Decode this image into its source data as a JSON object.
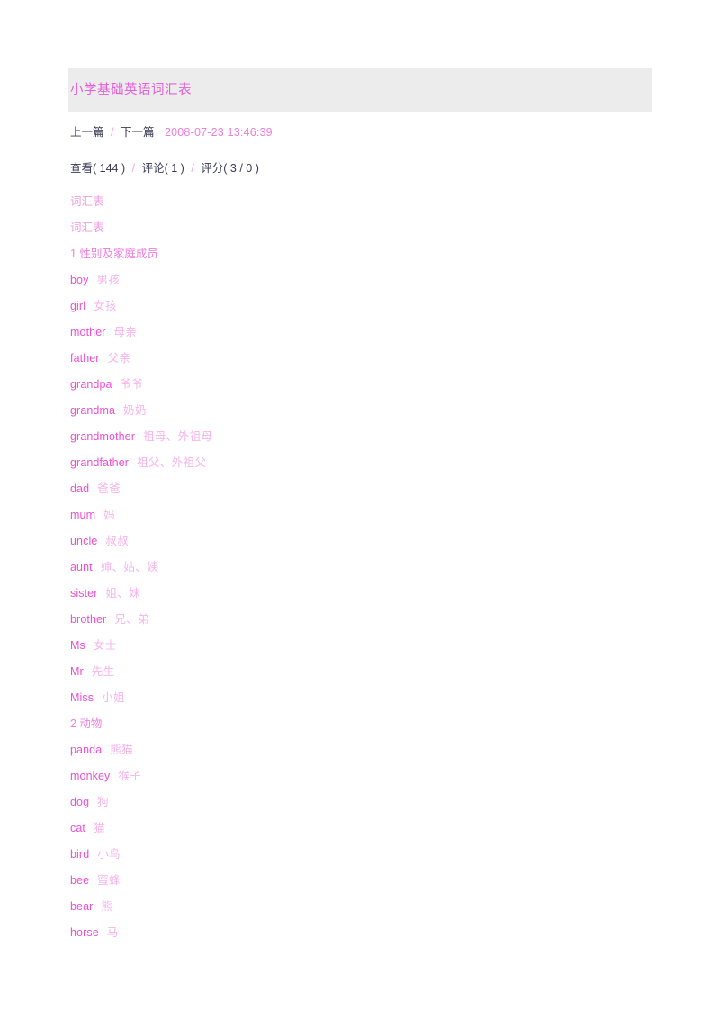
{
  "article": {
    "title": "小学基础英语词汇表",
    "nav": {
      "prev_label": "上一篇",
      "next_label": "下一篇",
      "separator": "/",
      "timestamp": "2008-07-23 13:46:39"
    },
    "stats": {
      "views": "查看( 144 )",
      "comments": "评论( 1 )",
      "rating": "评分( 3 / 0 )",
      "separator": "/"
    }
  },
  "colors": {
    "band_background": "#ececec",
    "title_text": "#e45fd8",
    "term_text": "#ef4fd4",
    "gloss_text": "#f7b4ec",
    "meta_text": "#3a3a55",
    "timestamp_text": "#f07fd8",
    "page_background": "#ffffff"
  },
  "body_lines": [
    {
      "type": "heading",
      "text": "词汇表"
    },
    {
      "type": "heading",
      "text": "词汇表"
    },
    {
      "type": "section",
      "text": "1 性别及家庭成员"
    },
    {
      "type": "entry",
      "term": "boy",
      "gloss": "男孩"
    },
    {
      "type": "entry",
      "term": "girl",
      "gloss": "女孩"
    },
    {
      "type": "entry",
      "term": "mother",
      "gloss": "母亲"
    },
    {
      "type": "entry",
      "term": "father",
      "gloss": "父亲"
    },
    {
      "type": "entry",
      "term": "grandpa",
      "gloss": "爷爷"
    },
    {
      "type": "entry",
      "term": "grandma",
      "gloss": "奶奶"
    },
    {
      "type": "entry",
      "term": "grandmother",
      "gloss": "祖母、外祖母"
    },
    {
      "type": "entry",
      "term": "grandfather",
      "gloss": "祖父、外祖父"
    },
    {
      "type": "entry",
      "term": "dad",
      "gloss": "爸爸"
    },
    {
      "type": "entry",
      "term": "mum",
      "gloss": "妈"
    },
    {
      "type": "entry",
      "term": "uncle",
      "gloss": "叔叔"
    },
    {
      "type": "entry",
      "term": "aunt",
      "gloss": "婶、姑、姨"
    },
    {
      "type": "entry",
      "term": "sister",
      "gloss": "姐、妹"
    },
    {
      "type": "entry",
      "term": "brother",
      "gloss": "兄、弟"
    },
    {
      "type": "entry",
      "term": "Ms",
      "gloss": "女士"
    },
    {
      "type": "entry",
      "term": "Mr",
      "gloss": "先生"
    },
    {
      "type": "entry",
      "term": "Miss",
      "gloss": "小姐"
    },
    {
      "type": "section",
      "text": "2 动物"
    },
    {
      "type": "entry",
      "term": "panda",
      "gloss": "熊猫"
    },
    {
      "type": "entry",
      "term": "monkey",
      "gloss": "猴子"
    },
    {
      "type": "entry",
      "term": "dog",
      "gloss": "狗"
    },
    {
      "type": "entry",
      "term": "cat",
      "gloss": "猫"
    },
    {
      "type": "entry",
      "term": "bird",
      "gloss": "小鸟"
    },
    {
      "type": "entry",
      "term": "bee",
      "gloss": "蜜蜂"
    },
    {
      "type": "entry",
      "term": "bear",
      "gloss": "熊"
    },
    {
      "type": "entry",
      "term": "horse",
      "gloss": "马"
    }
  ]
}
